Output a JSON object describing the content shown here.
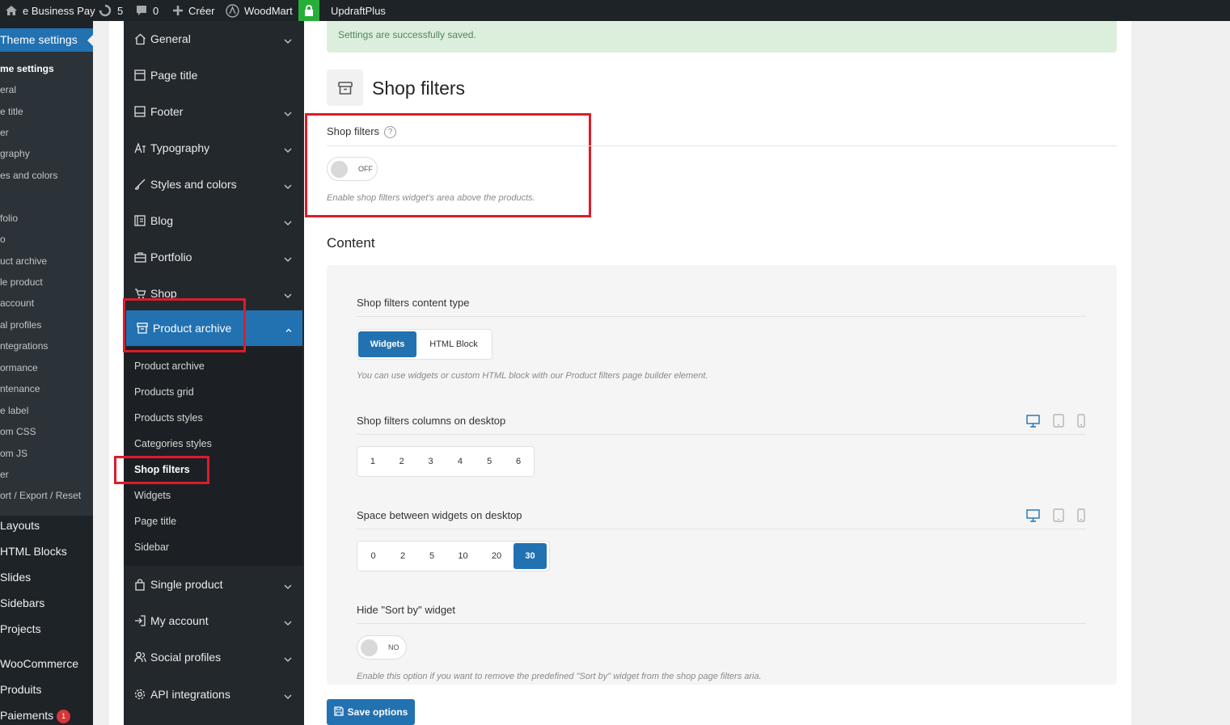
{
  "admin_bar": {
    "site_name": "e Business Pay",
    "updates_count": "5",
    "comments_count": "0",
    "create_label": "Créer",
    "woodmart_label": "WoodMart",
    "updraft_label": "UpdraftPlus"
  },
  "wp_menu": {
    "current": "Theme settings",
    "sub_items": [
      "me settings",
      "eral",
      "e title",
      "er",
      "graphy",
      "es and colors",
      "folio",
      "o",
      "uct archive",
      "le product",
      "account",
      "al profiles",
      "ntegrations",
      "ormance",
      "ntenance",
      "e label",
      "om CSS",
      "om JS",
      "er",
      "ort / Export / Reset"
    ],
    "main_items": [
      "Layouts",
      "HTML Blocks",
      "Slides",
      "Sidebars",
      "Projects",
      "WooCommerce",
      "Produits",
      "Paiements"
    ],
    "payments_badge": "1"
  },
  "settings_nav": {
    "items": [
      {
        "label": "General",
        "icon": "home-icon",
        "chevron": true
      },
      {
        "label": "Page title",
        "icon": "page-icon",
        "chevron": false
      },
      {
        "label": "Footer",
        "icon": "footer-icon",
        "chevron": true
      },
      {
        "label": "Typography",
        "icon": "typography-icon",
        "chevron": true
      },
      {
        "label": "Styles and colors",
        "icon": "brush-icon",
        "chevron": true
      },
      {
        "label": "Blog",
        "icon": "blog-icon",
        "chevron": true
      },
      {
        "label": "Portfolio",
        "icon": "briefcase-icon",
        "chevron": true
      },
      {
        "label": "Shop",
        "icon": "cart-icon",
        "chevron": true
      },
      {
        "label": "Product archive",
        "icon": "archive-icon",
        "chevron": true
      },
      {
        "label": "Single product",
        "icon": "bag-icon",
        "chevron": true
      },
      {
        "label": "My account",
        "icon": "login-icon",
        "chevron": true
      },
      {
        "label": "Social profiles",
        "icon": "users-icon",
        "chevron": true
      },
      {
        "label": "API integrations",
        "icon": "cog-icon",
        "chevron": true
      }
    ],
    "sub_items": [
      "Product archive",
      "Products grid",
      "Products styles",
      "Categories styles",
      "Shop filters",
      "Widgets",
      "Page title",
      "Sidebar"
    ],
    "current_sub": "Shop filters"
  },
  "notice": "Settings are successfully saved.",
  "section_title": "Shop filters",
  "shop_filters_field": {
    "title": "Shop filters",
    "hint": "?",
    "toggle": "OFF",
    "description": "Enable shop filters widget's area above the products."
  },
  "content_heading": "Content",
  "content_type": {
    "title": "Shop filters content type",
    "options": [
      "Widgets",
      "HTML Block"
    ],
    "selected": "Widgets",
    "description": "You can use widgets or custom HTML block with our Product filters page builder element."
  },
  "columns": {
    "title": "Shop filters columns on desktop",
    "options": [
      "1",
      "2",
      "3",
      "4",
      "5",
      "6"
    ],
    "selected": ""
  },
  "spacing": {
    "title": "Space between widgets on desktop",
    "options": [
      "0",
      "2",
      "5",
      "10",
      "20",
      "30"
    ],
    "selected": "30"
  },
  "sort_by": {
    "title": "Hide \"Sort by\" widget",
    "toggle": "NO",
    "description": "Enable this option if you want to remove the predefined \"Sort by\" widget from the shop page filters aria."
  },
  "save_label": "Save options",
  "colors": {
    "accent": "#2271b1",
    "highlight": "#dc1c2a",
    "success_bg": "#dcefdc"
  }
}
